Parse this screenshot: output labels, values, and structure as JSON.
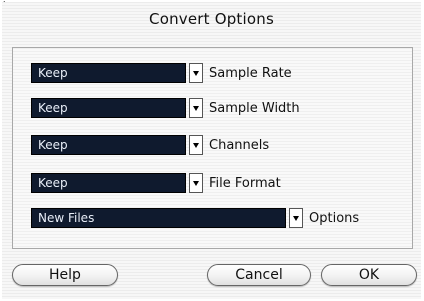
{
  "window": {
    "title": "Convert Options",
    "corner_mark": "′"
  },
  "rows": [
    {
      "value": "Keep",
      "label": "Sample Rate"
    },
    {
      "value": "Keep",
      "label": "Sample Width"
    },
    {
      "value": "Keep",
      "label": "Channels"
    },
    {
      "value": "Keep",
      "label": "File Format"
    },
    {
      "value": "New Files",
      "label": "Options"
    }
  ],
  "buttons": {
    "help": "Help",
    "cancel": "Cancel",
    "ok": "OK"
  },
  "icons": {
    "dropdown": "chevron-down-icon"
  }
}
